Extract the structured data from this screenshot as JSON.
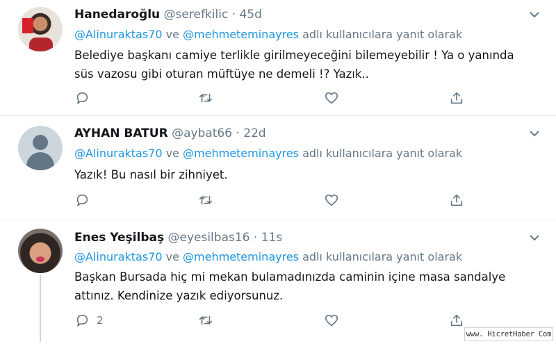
{
  "tweets": [
    {
      "name": "Hanedaroğlu",
      "handle": "@serefkilic",
      "sep": "·",
      "time": "45d",
      "reply_mention1": "@Alinuraktas70",
      "reply_ve": " ve ",
      "reply_mention2": "@mehmeteminayres",
      "reply_suffix": " adlı kullanıcılara yanıt olarak",
      "text_line1": "Belediye başkanı camiye terlikle girilmeyeceğini bilemeyebilir ! Ya o yanında",
      "text_line2": "süs vazosu gibi oturan müftüye ne demeli !? Yazık..",
      "reply_count": ""
    },
    {
      "name": "AYHAN BATUR",
      "handle": "@aybat66",
      "sep": "·",
      "time": "22d",
      "reply_mention1": "@Alinuraktas70",
      "reply_ve": " ve ",
      "reply_mention2": "@mehmeteminayres",
      "reply_suffix": " adlı kullanıcılara yanıt olarak",
      "text_line1": "Yazık! Bu nasıl bir zihniyet.",
      "text_line2": "",
      "reply_count": ""
    },
    {
      "name": "Enes Yeşilbaş",
      "handle": "@eyesilbas16",
      "sep": "·",
      "time": "11s",
      "reply_mention1": "@Alinuraktas70",
      "reply_ve": " ve ",
      "reply_mention2": "@mehmeteminayres",
      "reply_suffix": " adlı kullanıcılara yanıt olarak",
      "text_line1": "Başkan Bursada hiç mi mekan bulamadınızda caminin içine masa sandalye",
      "text_line2": "attınız. Kendinize yazık ediyorsunuz.",
      "reply_count": "2"
    }
  ],
  "watermark": "www. HicretHaber Com",
  "colors": {
    "accent": "#1b95e0",
    "muted": "#657786",
    "divider": "#e6ecf0"
  },
  "icons": [
    "reply-icon",
    "retweet-icon",
    "like-icon",
    "share-icon",
    "caret-down-icon"
  ]
}
